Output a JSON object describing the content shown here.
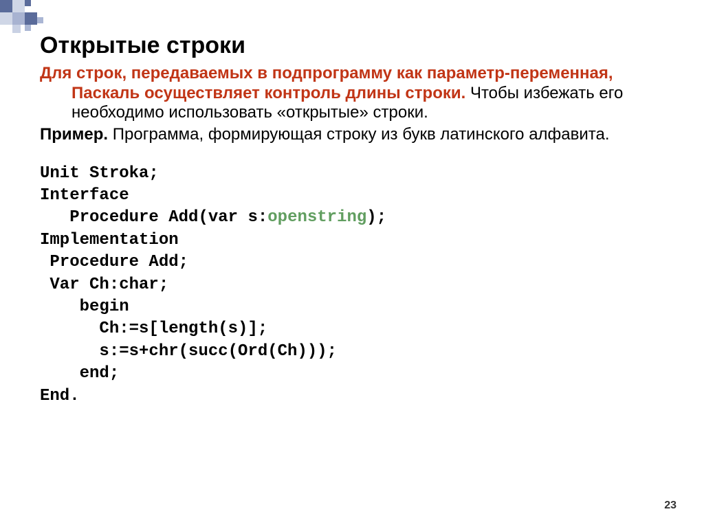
{
  "title": "Открытые строки",
  "p1": {
    "lead": "Для строк, передаваемых в подпрограмму как параметр-переменная, Паскаль осуществляет контроль длины строки.",
    "tail": " Чтобы избежать его необходимо использовать «открытые» строки."
  },
  "p2": {
    "lead": "Пример.",
    "tail": "  Программа, формирующая строку из букв латинского алфавита."
  },
  "code": {
    "l1": "Unit Stroka;",
    "l2": "Interface",
    "l3a": "   Procedure Add(var s:",
    "l3b": "openstring",
    "l3c": ");",
    "l4": "Implementation",
    "l5": " Procedure Add;",
    "l6": " Var Ch:char;",
    "l7": "    begin",
    "l8": "      Ch:=s[length(s)];",
    "l9": "      s:=s+chr(succ(Ord(Ch)));",
    "l10": "    end;",
    "l11": "End."
  },
  "page_number": "23"
}
